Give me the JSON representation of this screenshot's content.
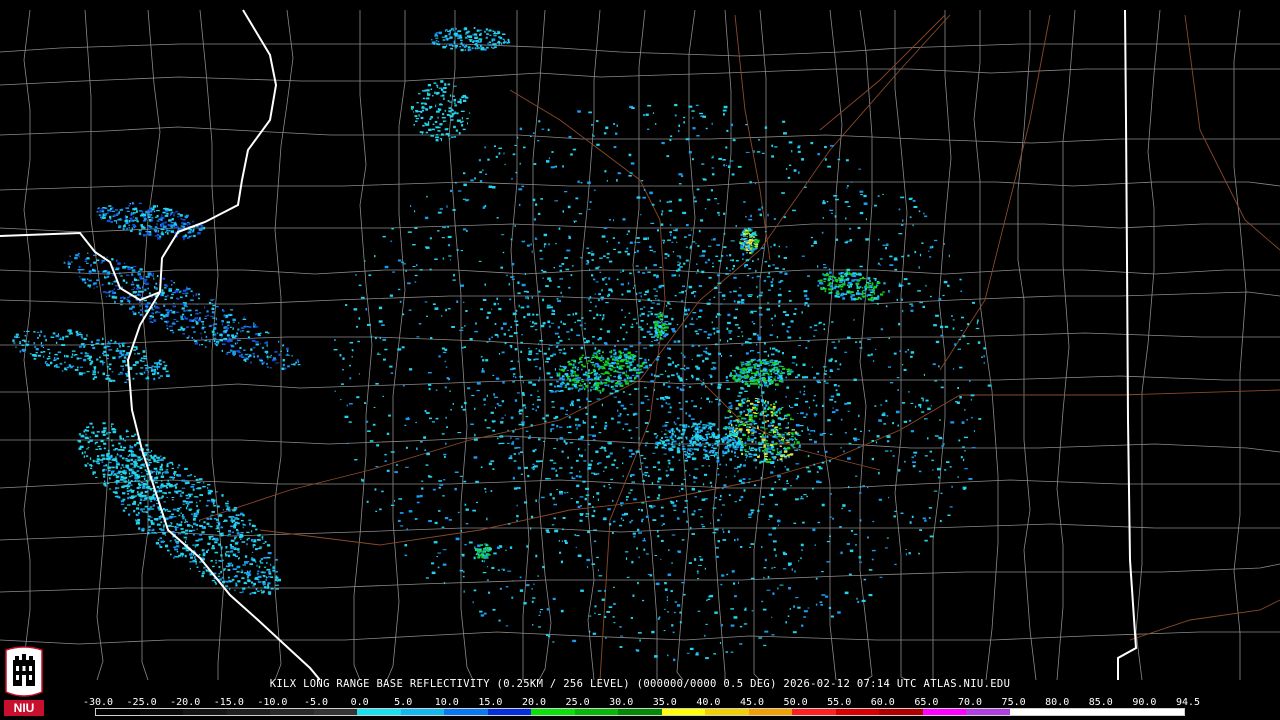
{
  "caption": "KILX LONG RANGE BASE REFLECTIVITY (0.25KM / 256 LEVEL) (000000/0000 0.5 DEG) 2026-02-12 07:14 UTC  ATLAS.NIU.EDU",
  "logo_text": "NIU",
  "colorbar": {
    "labels": [
      "-30.0",
      "-25.0",
      "-20.0",
      "-15.0",
      "-10.0",
      "-5.0",
      "0.0",
      "5.0",
      "10.0",
      "15.0",
      "20.0",
      "25.0",
      "30.0",
      "35.0",
      "40.0",
      "45.0",
      "50.0",
      "55.0",
      "60.0",
      "65.0",
      "70.0",
      "75.0",
      "80.0",
      "85.0",
      "90.0",
      "94.5"
    ],
    "colors": [
      "#000000",
      "#0a0a0a",
      "#151515",
      "#202020",
      "#2a2a2a",
      "#353535",
      "#19e0f0",
      "#12b8f0",
      "#0a78f0",
      "#0530e0",
      "#0ae00a",
      "#08b808",
      "#058a05",
      "#ffff00",
      "#f0d000",
      "#f0a000",
      "#ff2020",
      "#d80000",
      "#b00000",
      "#ff00ff",
      "#b040e0",
      "#ffffff",
      "#ffffff",
      "#ffffff",
      "#ffffff"
    ]
  },
  "echo_colors": {
    "light": "#23d4ee",
    "medium": "#1a9cf2",
    "strong": "#1450e0",
    "green": "#15d21e",
    "yellow": "#e6e632"
  },
  "map_colors": {
    "state_border": "#ffffff",
    "county_border": "#8a8a8a",
    "highway": "#8a4a2a"
  }
}
